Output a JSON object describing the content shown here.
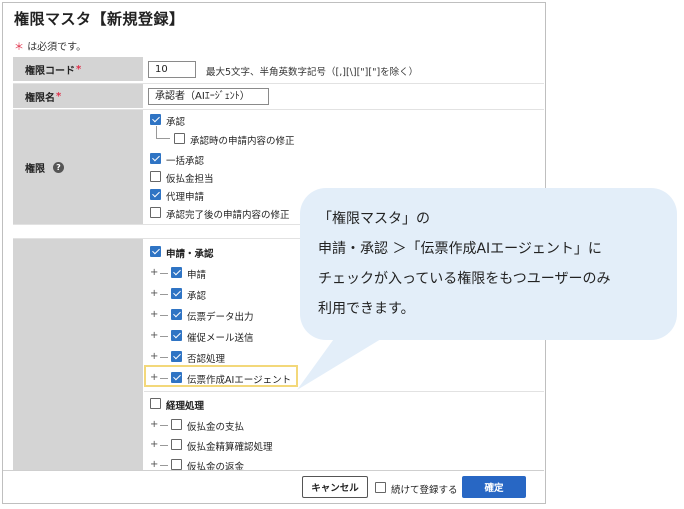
{
  "title": "権限マスタ【新規登録】",
  "required_note": {
    "star": "＊",
    "text": "は必須です。"
  },
  "fields": {
    "code": {
      "label": "権限コード",
      "value": "10",
      "hint": "最大5文字、半角英数字記号（[,][\\][\"][\"]を除く）"
    },
    "name": {
      "label": "権限名",
      "value": "承認者（AIｴｰｼﾞｪﾝﾄ）"
    },
    "authority_label": "権限",
    "help_icon": "?"
  },
  "authority_items": [
    {
      "label": "承認",
      "checked": true
    },
    {
      "label": "承認時の申請内容の修正",
      "checked": false
    },
    {
      "label": "一括承認",
      "checked": true
    },
    {
      "label": "仮払金担当",
      "checked": false
    },
    {
      "label": "代理申請",
      "checked": true
    },
    {
      "label": "承認完了後の申請内容の修正",
      "checked": false
    }
  ],
  "menu_section": {
    "label": "申請・承認",
    "checked": true
  },
  "menu_items": [
    {
      "label": "申請",
      "checked": true
    },
    {
      "label": "承認",
      "checked": true
    },
    {
      "label": "伝票データ出力",
      "checked": true
    },
    {
      "label": "催促メール送信",
      "checked": true
    },
    {
      "label": "否認処理",
      "checked": true
    },
    {
      "label": "伝票作成AIエージェント",
      "checked": true
    }
  ],
  "menu_section2": {
    "label": "経理処理",
    "checked": false
  },
  "menu_items2": [
    {
      "label": "仮払金の支払",
      "checked": false
    },
    {
      "label": "仮払金精算確認処理",
      "checked": false
    },
    {
      "label": "仮払金の返金",
      "checked": false
    }
  ],
  "footer": {
    "cancel": "キャンセル",
    "continue_label": "続けて登録する",
    "confirm": "確定"
  },
  "callout": {
    "lines": [
      "「権限マスタ」の",
      "申請・承認 ＞「伝票作成AIエージェント」に",
      "チェックが入っている権限をもつユーザーのみ",
      "利用できます。"
    ]
  },
  "colors": {
    "accent": "#2867c4",
    "checkbox": "#2f74c4",
    "highlight": "#f3d87a",
    "callout_bg": "#e3eef9",
    "required": "#e0304a"
  }
}
